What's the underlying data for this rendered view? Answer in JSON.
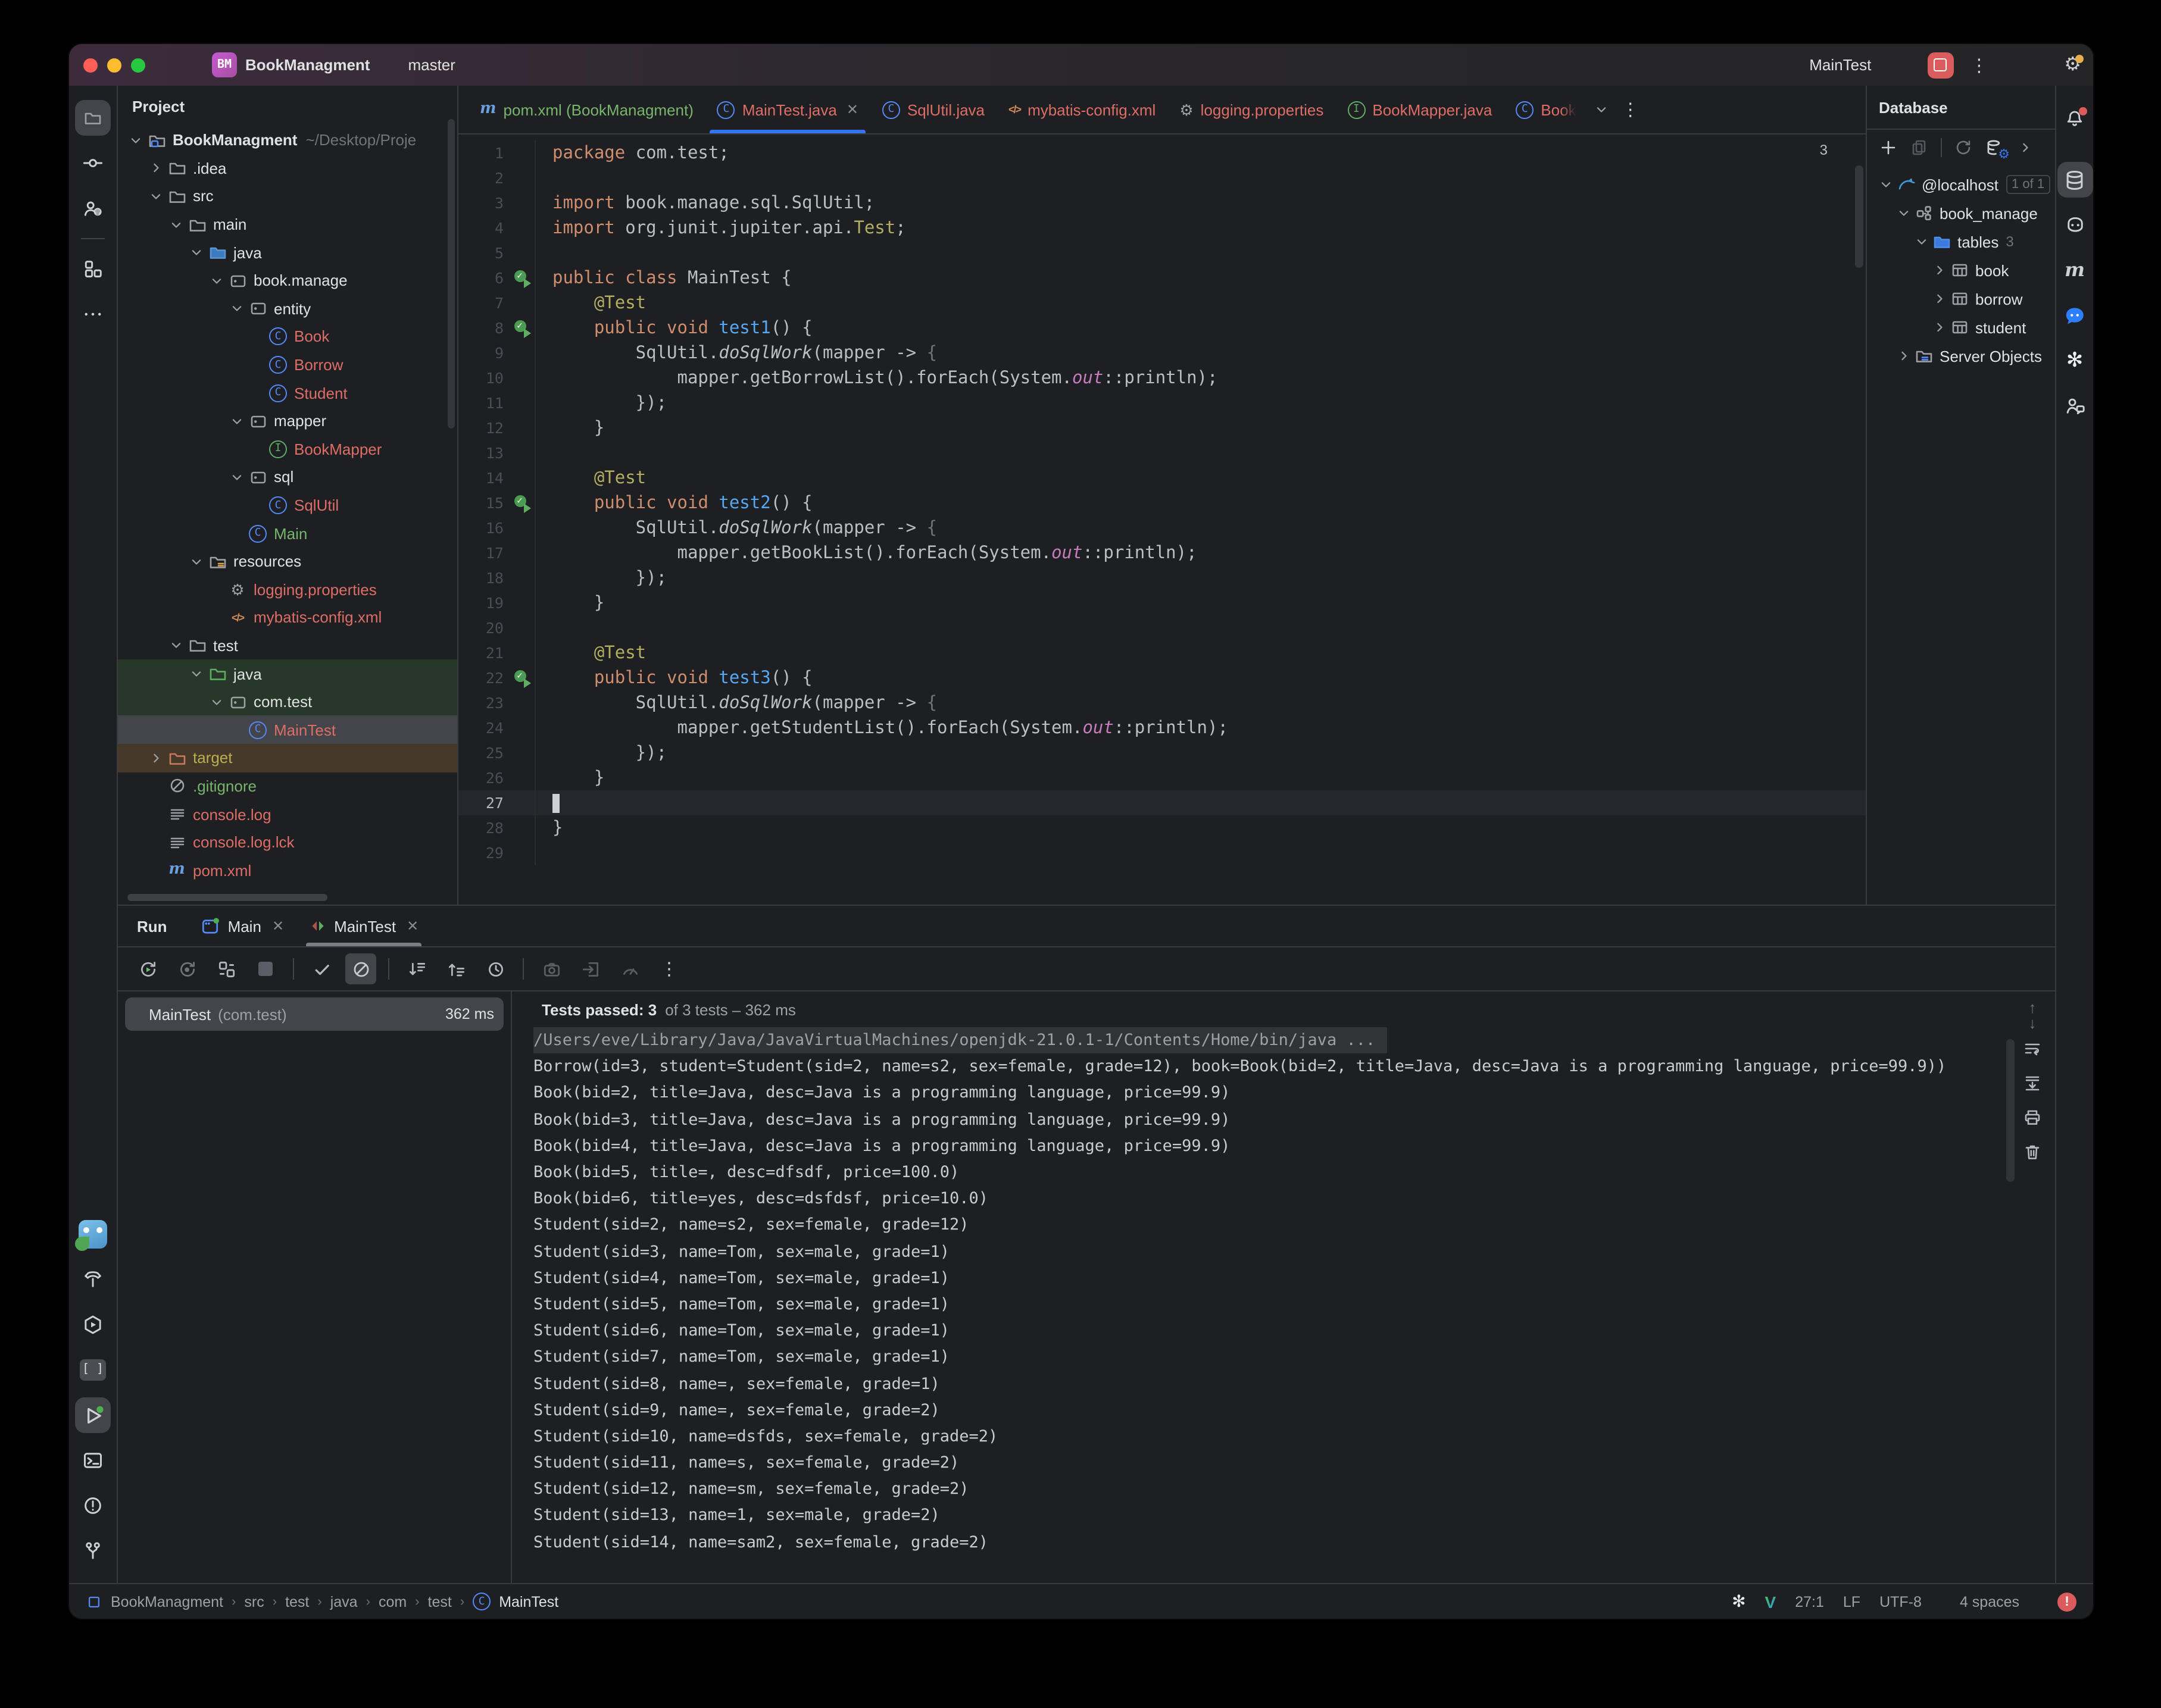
{
  "colors": {
    "accent_blue": "#3574f0",
    "error_red": "#db5c5c",
    "ok_green": "#5fad65",
    "warn_yellow": "#f2c55c",
    "file_red": "#dd6e66",
    "file_green": "#77b56b"
  },
  "title_bar": {
    "project_badge": "BM",
    "project_name": "BookManagment",
    "branch_name": "master",
    "run_config": "MainTest",
    "right_icons": [
      "run-config-junit-icon",
      "play-icon",
      "debug-icon",
      "stop-button",
      "kebab-icon",
      "add-user-icon",
      "search-icon",
      "settings-gear-icon"
    ]
  },
  "left_toolbar": {
    "top": [
      {
        "name": "project-folder-icon",
        "active": true
      },
      {
        "name": "commit-icon"
      },
      {
        "name": "user-question-icon"
      },
      {
        "name": "divider"
      },
      {
        "name": "structure-icon"
      },
      {
        "name": "more-icon"
      }
    ],
    "bottom": [
      {
        "name": "gopher-plugin-icon"
      },
      {
        "name": "build-hammer-icon"
      },
      {
        "name": "services-icon"
      },
      {
        "name": "brackets-icon"
      },
      {
        "name": "run-icon",
        "active": true
      },
      {
        "name": "terminal-icon"
      },
      {
        "name": "problems-icon"
      },
      {
        "name": "git-branch-icon"
      }
    ]
  },
  "project_panel": {
    "header": "Project",
    "tree": [
      {
        "label": "BookManagment",
        "extra": "~/Desktop/Proje",
        "level": 0,
        "chevron": "down",
        "icon": "project-folder",
        "bold": true
      },
      {
        "label": ".idea",
        "level": 1,
        "chevron": "right",
        "icon": "folder"
      },
      {
        "label": "src",
        "level": 1,
        "chevron": "down",
        "icon": "folder"
      },
      {
        "label": "main",
        "level": 2,
        "chevron": "down",
        "icon": "folder"
      },
      {
        "label": "java",
        "level": 3,
        "chevron": "down",
        "icon": "folder-source"
      },
      {
        "label": "book.manage",
        "level": 4,
        "chevron": "down",
        "icon": "package"
      },
      {
        "label": "entity",
        "level": 5,
        "chevron": "down",
        "icon": "package"
      },
      {
        "label": "Book",
        "level": 6,
        "icon": "class",
        "color": "red"
      },
      {
        "label": "Borrow",
        "level": 6,
        "icon": "class",
        "color": "red"
      },
      {
        "label": "Student",
        "level": 6,
        "icon": "class",
        "color": "red"
      },
      {
        "label": "mapper",
        "level": 5,
        "chevron": "down",
        "icon": "package"
      },
      {
        "label": "BookMapper",
        "level": 6,
        "icon": "interface",
        "color": "red"
      },
      {
        "label": "sql",
        "level": 5,
        "chevron": "down",
        "icon": "package"
      },
      {
        "label": "SqlUtil",
        "level": 6,
        "icon": "class",
        "color": "red"
      },
      {
        "label": "Main",
        "level": 5,
        "icon": "class",
        "color": "green"
      },
      {
        "label": "resources",
        "level": 3,
        "chevron": "down",
        "icon": "folder-resources"
      },
      {
        "label": "logging.properties",
        "level": 4,
        "icon": "gear-file",
        "color": "red"
      },
      {
        "label": "mybatis-config.xml",
        "level": 4,
        "icon": "xml-file",
        "color": "red"
      },
      {
        "label": "test",
        "level": 2,
        "chevron": "down",
        "icon": "folder"
      },
      {
        "label": "java",
        "level": 3,
        "chevron": "down",
        "icon": "folder-test",
        "row": "context"
      },
      {
        "label": "com.test",
        "level": 4,
        "chevron": "down",
        "icon": "package",
        "row": "context"
      },
      {
        "label": "MainTest",
        "level": 5,
        "icon": "class",
        "color": "red",
        "row": "selected"
      },
      {
        "label": "target",
        "level": 1,
        "chevron": "right",
        "icon": "folder-excluded",
        "color": "olive",
        "row": "excluded"
      },
      {
        "label": ".gitignore",
        "level": 1,
        "icon": "ignored-file",
        "color": "green"
      },
      {
        "label": "console.log",
        "level": 1,
        "icon": "log-file",
        "color": "red"
      },
      {
        "label": "console.log.lck",
        "level": 1,
        "icon": "log-file",
        "color": "red"
      },
      {
        "label": "pom.xml",
        "level": 1,
        "icon": "maven-file",
        "color": "red"
      }
    ]
  },
  "editor": {
    "tabs": [
      {
        "label": "pom.xml (BookManagment)",
        "icon": "maven-file",
        "color": "green"
      },
      {
        "label": "MainTest.java",
        "icon": "class",
        "color": "red",
        "active": true,
        "close": true
      },
      {
        "label": "SqlUtil.java",
        "icon": "class",
        "color": "red"
      },
      {
        "label": "mybatis-config.xml",
        "icon": "xml-file",
        "color": "red"
      },
      {
        "label": "logging.properties",
        "icon": "gear-file",
        "color": "red"
      },
      {
        "label": "BookMapper.java",
        "icon": "interface",
        "color": "red"
      },
      {
        "label": "Book",
        "icon": "class",
        "color": "red",
        "faded": true
      }
    ],
    "warning_count": "3",
    "lines": [
      {
        "n": "1",
        "t": [
          [
            "kw",
            "package"
          ],
          [
            "pl",
            " com.test;"
          ]
        ]
      },
      {
        "n": "2",
        "t": []
      },
      {
        "n": "3",
        "t": [
          [
            "kw",
            "import"
          ],
          [
            "pl",
            " book.manage.sql.SqlUtil;"
          ]
        ]
      },
      {
        "n": "4",
        "t": [
          [
            "kw",
            "import"
          ],
          [
            "pl",
            " org.junit.jupiter.api."
          ],
          [
            "ann",
            "Test"
          ],
          [
            "pl",
            ";"
          ]
        ]
      },
      {
        "n": "5",
        "t": []
      },
      {
        "n": "6",
        "g": true,
        "t": [
          [
            "kw",
            "public class"
          ],
          [
            "pl",
            " MainTest {"
          ]
        ]
      },
      {
        "n": "7",
        "t": [
          [
            "pl",
            "    "
          ],
          [
            "ann",
            "@Test"
          ]
        ]
      },
      {
        "n": "8",
        "g": true,
        "t": [
          [
            "pl",
            "    "
          ],
          [
            "kw",
            "public void"
          ],
          [
            "pl",
            " "
          ],
          [
            "mt",
            "test1"
          ],
          [
            "pl",
            "() {"
          ]
        ]
      },
      {
        "n": "9",
        "t": [
          [
            "pl",
            "        SqlUtil."
          ],
          [
            "it",
            "doSqlWork"
          ],
          [
            "pl",
            "(mapper -> "
          ],
          [
            "dim",
            "{"
          ]
        ]
      },
      {
        "n": "10",
        "t": [
          [
            "pl",
            "            mapper.getBorrowList().forEach(System."
          ],
          [
            "fd",
            "out"
          ],
          [
            "pl",
            "::println);"
          ]
        ]
      },
      {
        "n": "11",
        "t": [
          [
            "pl",
            "        });"
          ]
        ]
      },
      {
        "n": "12",
        "t": [
          [
            "pl",
            "    }"
          ]
        ]
      },
      {
        "n": "13",
        "t": []
      },
      {
        "n": "14",
        "t": [
          [
            "pl",
            "    "
          ],
          [
            "ann",
            "@Test"
          ]
        ]
      },
      {
        "n": "15",
        "g": true,
        "t": [
          [
            "pl",
            "    "
          ],
          [
            "kw",
            "public void"
          ],
          [
            "pl",
            " "
          ],
          [
            "mt",
            "test2"
          ],
          [
            "pl",
            "() {"
          ]
        ]
      },
      {
        "n": "16",
        "t": [
          [
            "pl",
            "        SqlUtil."
          ],
          [
            "it",
            "doSqlWork"
          ],
          [
            "pl",
            "(mapper -> "
          ],
          [
            "dim",
            "{"
          ]
        ]
      },
      {
        "n": "17",
        "t": [
          [
            "pl",
            "            mapper.getBookList().forEach(System."
          ],
          [
            "fd",
            "out"
          ],
          [
            "pl",
            "::println);"
          ]
        ]
      },
      {
        "n": "18",
        "t": [
          [
            "pl",
            "        });"
          ]
        ]
      },
      {
        "n": "19",
        "t": [
          [
            "pl",
            "    }"
          ]
        ]
      },
      {
        "n": "20",
        "t": []
      },
      {
        "n": "21",
        "t": [
          [
            "pl",
            "    "
          ],
          [
            "ann",
            "@Test"
          ]
        ]
      },
      {
        "n": "22",
        "g": true,
        "t": [
          [
            "pl",
            "    "
          ],
          [
            "kw",
            "public void"
          ],
          [
            "pl",
            " "
          ],
          [
            "mt",
            "test3"
          ],
          [
            "pl",
            "() {"
          ]
        ]
      },
      {
        "n": "23",
        "t": [
          [
            "pl",
            "        SqlUtil."
          ],
          [
            "it",
            "doSqlWork"
          ],
          [
            "pl",
            "(mapper -> "
          ],
          [
            "dim",
            "{"
          ]
        ]
      },
      {
        "n": "24",
        "t": [
          [
            "pl",
            "            mapper.getStudentList().forEach(System."
          ],
          [
            "fd",
            "out"
          ],
          [
            "pl",
            "::println);"
          ]
        ]
      },
      {
        "n": "25",
        "t": [
          [
            "pl",
            "        });"
          ]
        ]
      },
      {
        "n": "26",
        "t": [
          [
            "pl",
            "    }"
          ]
        ]
      },
      {
        "n": "27",
        "active": true,
        "t": []
      },
      {
        "n": "28",
        "t": [
          [
            "pl",
            "}"
          ]
        ]
      },
      {
        "n": "29",
        "t": []
      }
    ]
  },
  "database_panel": {
    "title": "Database",
    "toolbar": [
      "add-icon",
      "copy-icon",
      "divider",
      "refresh-icon",
      "data-source-settings-icon",
      "chevron-right-icon"
    ],
    "tree": [
      {
        "label": "@localhost",
        "level": 0,
        "chevron": "down",
        "icon": "mysql",
        "badge": "1 of 1"
      },
      {
        "label": "book_manage",
        "level": 1,
        "chevron": "down",
        "icon": "schema"
      },
      {
        "label": "tables",
        "level": 2,
        "chevron": "down",
        "icon": "folder-blue",
        "count": "3"
      },
      {
        "label": "book",
        "level": 3,
        "chevron": "right",
        "icon": "table"
      },
      {
        "label": "borrow",
        "level": 3,
        "chevron": "right",
        "icon": "table"
      },
      {
        "label": "student",
        "level": 3,
        "chevron": "right",
        "icon": "table"
      },
      {
        "label": "Server Objects",
        "level": 1,
        "chevron": "right",
        "icon": "server-folder"
      }
    ]
  },
  "right_toolbar": [
    "notifications-bell-icon",
    "database-icon-active",
    "copilot-icon",
    "maven-icon",
    "chat-bubble-icon",
    "openai-icon",
    "people-chat-icon"
  ],
  "run_panel": {
    "label": "Run",
    "tabs": [
      {
        "label": "Main",
        "icon": "app-window",
        "close": true
      },
      {
        "label": "MainTest",
        "icon": "run-config-junit-icon",
        "close": true,
        "active": true
      }
    ],
    "toolbar": [
      "rerun-icon",
      "rerun-failed-icon",
      "restart-icon",
      "stop-square-icon",
      "divider",
      "check-icon",
      "hide-passed-icon-active",
      "divider",
      "expand-all-icon",
      "collapse-all-icon",
      "clock-icon",
      "divider",
      "camera-icon",
      "export-icon",
      "gauge-icon",
      "kebab-icon"
    ],
    "test_tree": {
      "name": "MainTest",
      "package": "(com.test)",
      "time": "362 ms"
    },
    "results_header": {
      "strong": "Tests passed: 3",
      "rest": "of 3 tests – 362 ms"
    },
    "console": [
      {
        "text": "/Users/eve/Library/Java/JavaVirtualMachines/openjdk-21.0.1-1/Contents/Home/bin/java ...",
        "cmd": true
      },
      {
        "text": "Borrow(id=3, student=Student(sid=2, name=s2, sex=female, grade=12), book=Book(bid=2, title=Java, desc=Java is a programming language, price=99.9))"
      },
      {
        "text": "Book(bid=2, title=Java, desc=Java is a programming language, price=99.9)"
      },
      {
        "text": "Book(bid=3, title=Java, desc=Java is a programming language, price=99.9)"
      },
      {
        "text": "Book(bid=4, title=Java, desc=Java is a programming language, price=99.9)"
      },
      {
        "text": "Book(bid=5, title=, desc=dfsdf, price=100.0)"
      },
      {
        "text": "Book(bid=6, title=yes, desc=dsfdsf, price=10.0)"
      },
      {
        "text": "Student(sid=2, name=s2, sex=female, grade=12)"
      },
      {
        "text": "Student(sid=3, name=Tom, sex=male, grade=1)"
      },
      {
        "text": "Student(sid=4, name=Tom, sex=male, grade=1)"
      },
      {
        "text": "Student(sid=5, name=Tom, sex=male, grade=1)"
      },
      {
        "text": "Student(sid=6, name=Tom, sex=male, grade=1)"
      },
      {
        "text": "Student(sid=7, name=Tom, sex=male, grade=1)"
      },
      {
        "text": "Student(sid=8, name=, sex=female, grade=1)"
      },
      {
        "text": "Student(sid=9, name=, sex=female, grade=2)"
      },
      {
        "text": "Student(sid=10, name=dsfds, sex=female, grade=2)"
      },
      {
        "text": "Student(sid=11, name=s, sex=female, grade=2)"
      },
      {
        "text": "Student(sid=12, name=sm, sex=female, grade=2)"
      },
      {
        "text": "Student(sid=13, name=1, sex=male, grade=2)"
      },
      {
        "text": "Student(sid=14, name=sam2, sex=female, grade=2)"
      }
    ],
    "console_gutter": [
      "up-arrow-icon",
      "down-arrow-icon",
      "soft-wrap-icon",
      "scroll-end-icon",
      "print-icon",
      "clear-icon"
    ]
  },
  "status_bar": {
    "breadcrumbs": [
      "BookManagment",
      "src",
      "test",
      "java",
      "com",
      "test",
      "MainTest"
    ],
    "caret_position": "27:1",
    "line_ending": "LF",
    "encoding": "UTF-8",
    "indent": "4 spaces"
  }
}
